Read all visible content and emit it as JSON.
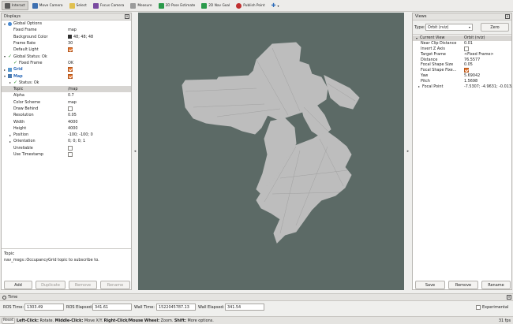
{
  "toolbar": {
    "tools": [
      {
        "label": "Interact",
        "icon": "interact-icon",
        "active": true
      },
      {
        "label": "Move Camera",
        "icon": "move-camera-icon"
      },
      {
        "label": "Select",
        "icon": "select-icon"
      },
      {
        "label": "Focus Camera",
        "icon": "focus-camera-icon"
      },
      {
        "label": "Measure",
        "icon": "measure-icon"
      },
      {
        "label": "2D Pose Estimate",
        "icon": "pose-estimate-icon"
      },
      {
        "label": "2D Nav Goal",
        "icon": "nav-goal-icon"
      },
      {
        "label": "Publish Point",
        "icon": "publish-point-icon"
      }
    ]
  },
  "displays": {
    "title": "Displays",
    "rows": [
      {
        "indent": 0,
        "arrow": "▾",
        "icon": "globe",
        "label": "Global Options",
        "value": ""
      },
      {
        "indent": 1,
        "label": "Fixed Frame",
        "value": "map"
      },
      {
        "indent": 1,
        "label": "Background Color",
        "value": "48; 48; 48",
        "swatch": true
      },
      {
        "indent": 1,
        "label": "Frame Rate",
        "value": "30"
      },
      {
        "indent": 1,
        "label": "Default Light",
        "check": true
      },
      {
        "indent": 0,
        "arrow": "▾",
        "tick": true,
        "label": "Global Status: Ok",
        "value": ""
      },
      {
        "indent": 1,
        "tick": true,
        "label": "Fixed Frame",
        "value": "OK"
      },
      {
        "indent": 0,
        "arrow": "▸",
        "icon": "grid",
        "label": "Grid",
        "blue": true,
        "check": true
      },
      {
        "indent": 0,
        "arrow": "▾",
        "icon": "map",
        "label": "Map",
        "blue": true,
        "check": true
      },
      {
        "indent": 1,
        "arrow": "▸",
        "tick": true,
        "label": "Status: Ok",
        "value": ""
      },
      {
        "indent": 1,
        "label": "Topic",
        "value": "/map",
        "selected": true
      },
      {
        "indent": 1,
        "label": "Alpha",
        "value": "0.7"
      },
      {
        "indent": 1,
        "label": "Color Scheme",
        "value": "map"
      },
      {
        "indent": 1,
        "label": "Draw Behind",
        "check": false
      },
      {
        "indent": 1,
        "label": "Resolution",
        "value": "0.05"
      },
      {
        "indent": 1,
        "label": "Width",
        "value": "4000"
      },
      {
        "indent": 1,
        "label": "Height",
        "value": "4000"
      },
      {
        "indent": 1,
        "arrow": "▸",
        "label": "Position",
        "value": "-100; -100; 0"
      },
      {
        "indent": 1,
        "arrow": "▸",
        "label": "Orientation",
        "value": "0; 0; 0; 1"
      },
      {
        "indent": 1,
        "label": "Unreliable",
        "check": false
      },
      {
        "indent": 1,
        "label": "Use Timestamp",
        "check": false
      }
    ],
    "help_title": "Topic",
    "help_text": "nav_msgs::OccupancyGrid topic to subscribe to.",
    "buttons": {
      "add": "Add",
      "duplicate": "Duplicate",
      "remove": "Remove",
      "rename": "Rename"
    }
  },
  "views": {
    "title": "Views",
    "type_label": "Type:",
    "type_value": "Orbit (rviz)",
    "zero": "Zero",
    "rows": [
      {
        "label": "Current View",
        "value": "Orbit (rviz)",
        "header": true
      },
      {
        "label": "Near Clip Distance",
        "value": "0.01"
      },
      {
        "label": "Invert Z Axis",
        "check": false
      },
      {
        "label": "Target Frame",
        "value": "<Fixed Frame>"
      },
      {
        "label": "Distance",
        "value": "76.5577"
      },
      {
        "label": "Focal Shape Size",
        "value": "0.05"
      },
      {
        "label": "Focal Shape Fixe...",
        "check": true
      },
      {
        "label": "Yaw",
        "value": "5.69042"
      },
      {
        "label": "Pitch",
        "value": "1.5698"
      },
      {
        "label": "Focal Point",
        "value": "-7.5307; -4.9631; -0.013...",
        "arrow": "▸"
      }
    ],
    "buttons": {
      "save": "Save",
      "remove": "Remove",
      "rename": "Rename"
    }
  },
  "time": {
    "title": "Time",
    "ros_time_label": "ROS Time:",
    "ros_time": "1303.49",
    "ros_elapsed_label": "ROS Elapsed:",
    "ros_elapsed": "341.61",
    "wall_time_label": "Wall Time:",
    "wall_time": "1522045787.13",
    "wall_elapsed_label": "Wall Elapsed:",
    "wall_elapsed": "341.54",
    "experimental": "Experimental"
  },
  "status": {
    "reset": "Reset",
    "left_click": "Left-Click:",
    "left_click_text": " Rotate. ",
    "middle_click": "Middle-Click:",
    "middle_click_text": " Move X/Y. ",
    "right_click": "Right-Click/Mouse Wheel:",
    "right_click_text": " Zoom. ",
    "shift": "Shift:",
    "shift_text": " More options.",
    "fps": "31 fps"
  },
  "colors": {
    "viewport_bg": "#5c6a66",
    "map_free": "#bdbdbd",
    "accent_orange": "#e8772e"
  }
}
